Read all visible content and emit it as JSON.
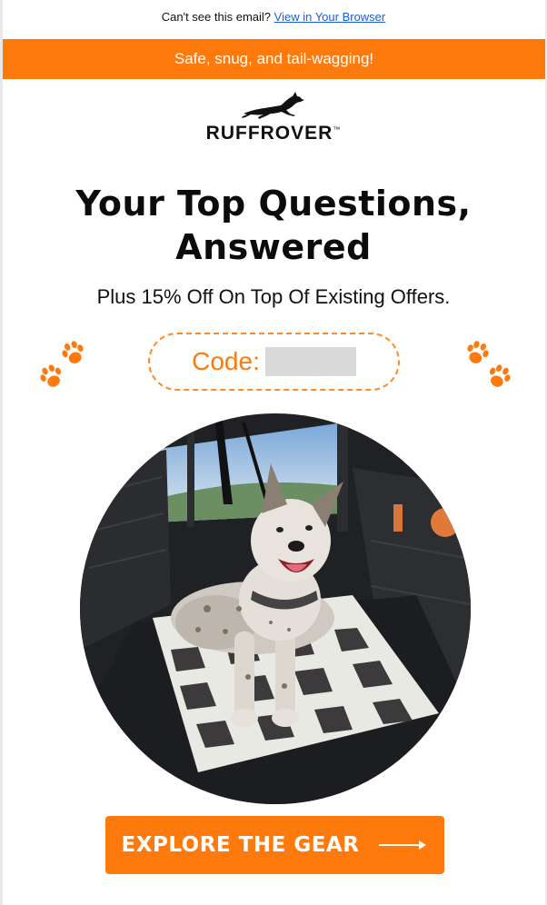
{
  "preheader": {
    "text": "Can't see this email?",
    "link_text": "View in Your Browser"
  },
  "banner": {
    "text": "Safe, snug, and tail-wagging!"
  },
  "logo": {
    "wordmark": "RUFFROVER",
    "trademark": "™"
  },
  "hero": {
    "headline_line1": "Your Top Questions,",
    "headline_line2": "Answered",
    "subline": "Plus 15% Off On Top Of Existing Offers."
  },
  "promo": {
    "code_label": "Code:"
  },
  "cta": {
    "label": "EXPLORE THE GEAR"
  },
  "colors": {
    "accent": "#ff7a0d",
    "link": "#1a5fd6",
    "code_mask": "#d9d9d9"
  },
  "icons": [
    "paw-icon",
    "arrow-right-icon",
    "running-dog-logo-icon"
  ]
}
